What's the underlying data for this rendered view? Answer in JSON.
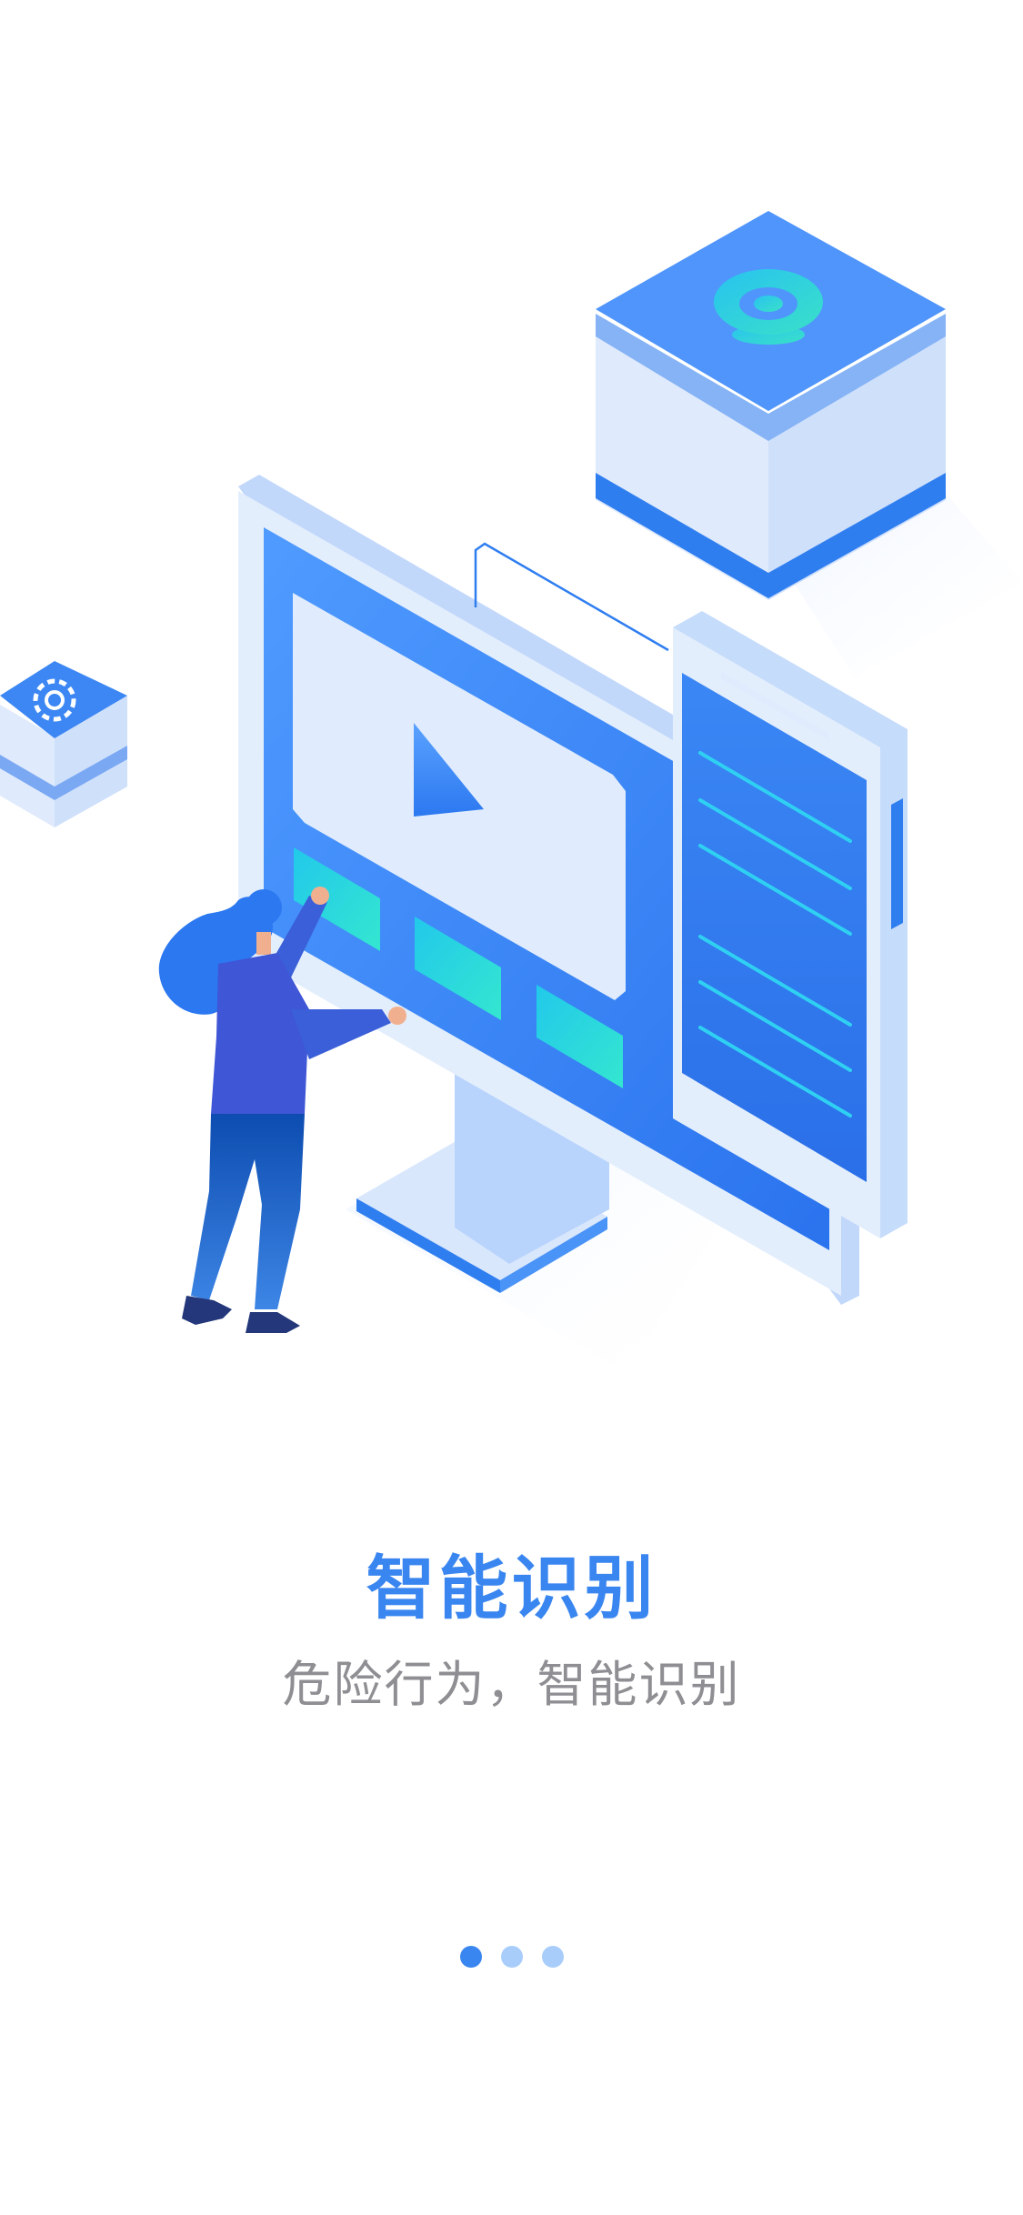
{
  "onboarding": {
    "title": "智能识别",
    "subtitle": "危险行为，智能识别",
    "pages": 3,
    "current_page": 1
  },
  "illustration": {
    "icons": [
      "camera-icon",
      "gear-icon",
      "play-icon"
    ]
  },
  "colors": {
    "accent": "#3a86f0",
    "dot_inactive": "#a9cdfb",
    "subtitle": "#8e8e93",
    "panel_light": "#e0ecfd",
    "teal": "#2fd8e2"
  }
}
